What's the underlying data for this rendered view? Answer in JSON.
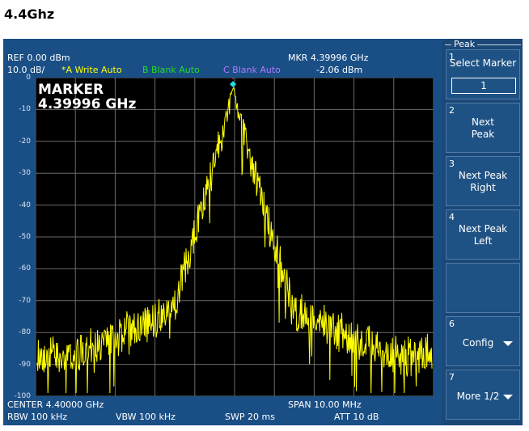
{
  "page_title": "4.4Ghz",
  "header": {
    "ref": "REF  0.00 dBm",
    "scale": "10.0 dB/",
    "trace_a": "*A Write Auto",
    "trace_b": "B Blank Auto",
    "trace_c": "C Blank Auto",
    "mkr_freq": "MKR 4.39996 GHz",
    "mkr_level": "-2.06 dBm"
  },
  "marker_box": {
    "label": "MARKER",
    "freq": "4.39996 GHz"
  },
  "y_labels": [
    "0",
    "-10",
    "-20",
    "-30",
    "-40",
    "-50",
    "-60",
    "-70",
    "-80",
    "-90",
    "-100"
  ],
  "footer": {
    "center": "CENTER 4.40000  GHz",
    "span": "SPAN 10.00 MHz",
    "rbw": "RBW  100 kHz",
    "vbw": "VBW  100 kHz",
    "swp": "SWP  20 ms",
    "att": "ATT 10 dB"
  },
  "softkeys": {
    "title": "Peak",
    "keys": [
      {
        "num": "1",
        "label": "Select Marker",
        "value": "1"
      },
      {
        "num": "2",
        "label_line1": "Next",
        "label_line2": "Peak"
      },
      {
        "num": "3",
        "label_line1": "Next Peak",
        "label_line2": "Right"
      },
      {
        "num": "4",
        "label_line1": "Next Peak",
        "label_line2": "Left"
      },
      {
        "num": "",
        "label_line1": "",
        "label_line2": ""
      },
      {
        "num": "6",
        "label": "Config"
      },
      {
        "num": "7",
        "label": "More 1/2"
      }
    ]
  },
  "colors": {
    "trace_a": "#ffff00",
    "trace_b": "#22dd22",
    "trace_c": "#aa66ff",
    "marker": "#22dddd",
    "grid": "#6a6a6a",
    "background": "#000000"
  },
  "chart_data": {
    "type": "line",
    "ylim": [
      -100,
      0
    ],
    "y_unit": "dBm",
    "x_center_ghz": 4.4,
    "x_span_mhz": 10.0,
    "marker": {
      "x_ghz": 4.39996,
      "y_dbm": -2.06
    },
    "noise_floor_dbm": -83
  }
}
